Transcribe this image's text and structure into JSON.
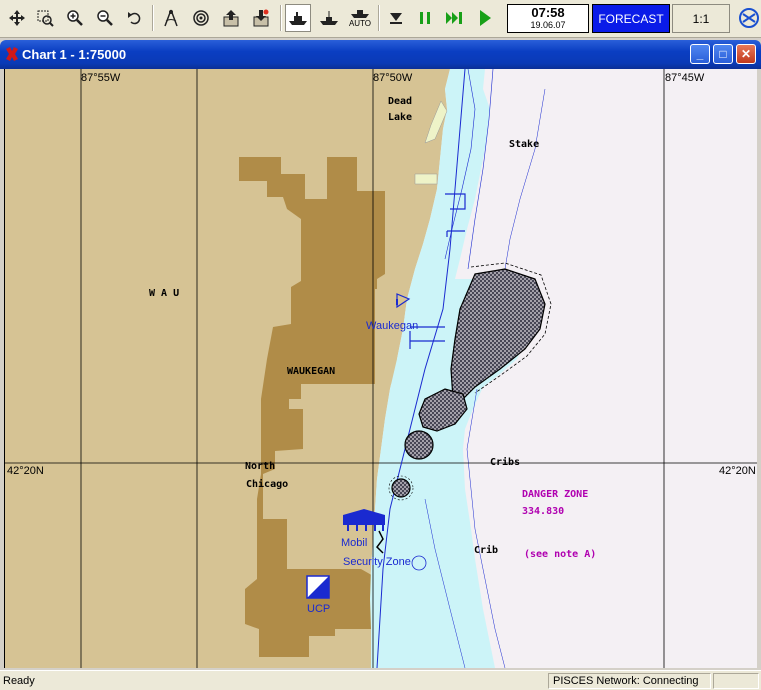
{
  "toolbar": {
    "buttons": [
      "pan-icon",
      "zoom-window-icon",
      "zoom-in-icon",
      "zoom-out-icon",
      "undo-view-icon",
      "measure-icon",
      "target-icon",
      "export-icon",
      "import-icon",
      "ship-icon",
      "ship-alt-icon",
      "auto-icon",
      "stop-icon",
      "pause-icon",
      "fast-forward-icon",
      "play-icon"
    ],
    "auto_label": "AUTO",
    "clock_time": "07:58",
    "clock_date": "19.06.07",
    "forecast_label": "FORECAST",
    "scale_label": "1:1",
    "colors": {
      "forecast_bg": "#0a1be8",
      "play_green": "#18a018"
    }
  },
  "window": {
    "title": "Chart 1 - 1:75000",
    "minimize_label": "_",
    "maximize_label": "□",
    "close_label": "✕"
  },
  "chart": {
    "longitude_labels": [
      "87°55W",
      "87°50W",
      "87°45W"
    ],
    "latitude_left": "42°20N",
    "latitude_right": "42°20N",
    "places": {
      "dead_lake_1": "Dead",
      "dead_lake_2": "Lake",
      "stake": "Stake",
      "wau": "W A U",
      "waukegan_town": "WAUKEGAN",
      "waukegan_harbor": "Waukegan",
      "north_chicago_1": "North",
      "north_chicago_2": "Chicago",
      "cribs": "Cribs",
      "crib": "Crib",
      "mobil": "Mobil",
      "security_zone": "Security Zone",
      "ucp": "UCP"
    },
    "danger_zone": "DANGER ZONE",
    "danger_freq": "334.830",
    "note": "(see note A)",
    "colors": {
      "land": "#d6c394",
      "urban": "#b08c48",
      "shallow": "#ccf4f8",
      "deep": "#f4f0f4",
      "chart_blue": "#1a2ad0",
      "magenta": "#b000b0"
    }
  },
  "status": {
    "ready": "Ready",
    "network": "PISCES Network: Connecting"
  }
}
